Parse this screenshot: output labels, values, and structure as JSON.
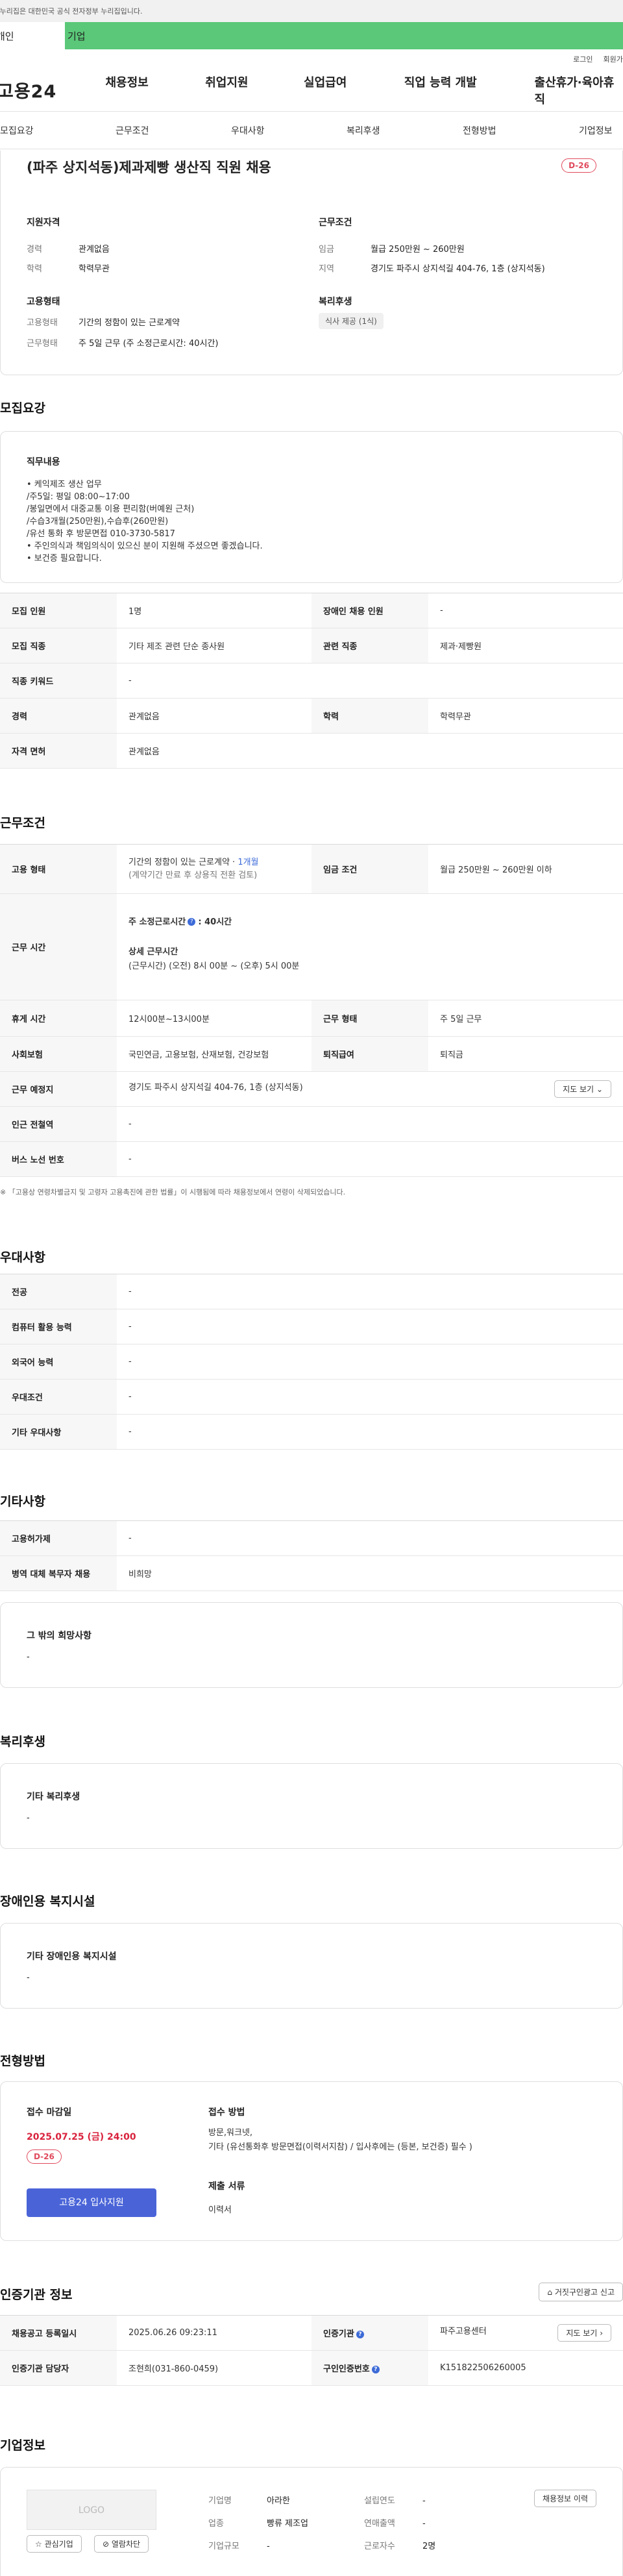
{
  "gov_notice": "이 누리집은 대한민국 공식 전자정부 누리집입니다.",
  "tabs": [
    "개인",
    "기업"
  ],
  "util_links": [
    "로그인",
    "회원가입"
  ],
  "logo": "고용24",
  "gnb": [
    "채용정보",
    "취업지원",
    "실업급여",
    "직업 능력 개발",
    "출산휴가·육아휴직"
  ],
  "snb": [
    "모집요강",
    "근무조건",
    "우대사항",
    "복리후생",
    "전형방법",
    "기업정보"
  ],
  "summary": {
    "title": "(파주 상지석동)제과제빵 생산직 직원 채용",
    "dday": "D-26",
    "qual_title": "지원자격",
    "qual": [
      {
        "k": "경력",
        "v": "관계없음"
      },
      {
        "k": "학력",
        "v": "학력무관"
      }
    ],
    "cond_title": "근무조건",
    "cond": [
      {
        "k": "임금",
        "v": "월급 250만원 ~ 260만원"
      },
      {
        "k": "지역",
        "v": "경기도 파주시 상지석길 404-76, 1층 (상지석동)"
      }
    ],
    "emp_title": "고용형태",
    "emp": [
      {
        "k": "고용형태",
        "v": "기간의 정함이 있는 근로계약"
      },
      {
        "k": "근무형태",
        "v": "주 5일 근무 (주 소정근로시간: 40시간)"
      }
    ],
    "welfare_title": "복리후생",
    "welfare_tag": "식사 제공 (1식)"
  },
  "recruit": {
    "section_title": "모집요강",
    "duty_title": "직무내용",
    "duty_lines": [
      "• 케익제조 생산 업무",
      "/주5일: 평일 08:00~17:00",
      "/봉일면에서 대중교통 이용 편리함(버예원 근처)",
      "/수습3개월(250만원),수습후(260만원)",
      "/유선 통화 후 방문면접 010-3730-5817",
      "• 주인의식과 책임의식이 있으신 분이 지원해 주셨으면 좋겠습니다.",
      "• 보건증 필요합니다."
    ],
    "rows": [
      [
        {
          "k": "모집 인원",
          "v": "1명"
        },
        {
          "k": "장애인 채용 인원",
          "v": "-"
        }
      ],
      [
        {
          "k": "모집 직종",
          "v": "기타 제조 관련 단순 종사원"
        },
        {
          "k": "관련 직종",
          "v": "제과·제빵원"
        }
      ],
      [
        {
          "k": "직종 키워드",
          "v": "-"
        }
      ],
      [
        {
          "k": "경력",
          "v": "관계없음"
        },
        {
          "k": "학력",
          "v": "학력무관"
        }
      ],
      [
        {
          "k": "자격 면허",
          "v": "관계없음"
        }
      ]
    ]
  },
  "work": {
    "section_title": "근무조건",
    "emp_type_k": "고용 형태",
    "emp_type_v1": "기간의 정함이 있는 근로계약 · ",
    "emp_type_highlight": "1개월",
    "emp_type_v2": "(계약기간 만료 후 상용직 전환 검토)",
    "wage_k": "임금 조건",
    "wage_v": "월급 250만원 ~ 260만원 이하",
    "hours_k": "근무 시간",
    "hours_main": "주 소정근로시간",
    "hours_main_v": ": 40시간",
    "hours_detail_title": "상세 근무시간",
    "hours_detail": "(근무시간) (오전) 8시 00분 ~ (오후) 5시 00분",
    "break_k": "휴게 시간",
    "break_v": "12시00분~13시00분",
    "type_k": "근무 형태",
    "type_v": "주 5일 근무",
    "ins_k": "사회보험",
    "ins_v": "국민연금, 고용보험, 산재보험, 건강보험",
    "sev_k": "퇴직급여",
    "sev_v": "퇴직금",
    "place_k": "근무 예정지",
    "place_v": "경기도 파주시 상지석길 404-76, 1층 (상지석동)",
    "map_btn": "지도 보기",
    "station_k": "인근 전철역",
    "station_v": "-",
    "bus_k": "버스 노선 번호",
    "bus_v": "-",
    "note": "※ 「고용상 연령차별금지 및 고령자 고용촉진에 관한 법률」이 시행됨에 따라 채용정보에서 연령이 삭제되었습니다."
  },
  "pref": {
    "section_title": "우대사항",
    "rows": [
      {
        "k": "전공",
        "v": "-"
      },
      {
        "k": "컴퓨터 활용 능력",
        "v": "-"
      },
      {
        "k": "외국어 능력",
        "v": "-"
      },
      {
        "k": "우대조건",
        "v": "-"
      },
      {
        "k": "기타 우대사항",
        "v": "-"
      }
    ]
  },
  "etc": {
    "section_title": "기타사항",
    "rows": [
      {
        "k": "고용허가제",
        "v": "-"
      },
      {
        "k": "병역 대체 복무자 채용",
        "v": "비희망"
      }
    ],
    "wish_title": "그 밖의 희망사항",
    "wish_v": "-"
  },
  "welfare": {
    "section_title": "복리후생",
    "sub_title": "기타 복리후생",
    "v": "-"
  },
  "disabled": {
    "section_title": "장애인용 복지시설",
    "sub_title": "기타 장애인용 복지시설",
    "v": "-"
  },
  "process": {
    "section_title": "전형방법",
    "deadline_title": "접수 마감일",
    "deadline": "2025.07.25 (금) 24:00",
    "dday": "D-26",
    "apply_btn": "고용24 입사지원",
    "method_title": "접수 방법",
    "method_lines": [
      "방문,워크넷,",
      "기타 (유선통화후 방문면접(이력서지참) / 입사후에는 (등본, 보건증) 필수 )"
    ],
    "docs_title": "제출 서류",
    "docs": "이력서"
  },
  "cert": {
    "section_title": "인증기관 정보",
    "report_btn": "거짓구인광고 신고",
    "rows": [
      [
        {
          "k": "채용공고 등록일시",
          "v": "2025.06.26 09:23:11"
        },
        {
          "k": "인증기관",
          "v": "파주고용센터",
          "btn": "지도 보기"
        }
      ],
      [
        {
          "k": "인증기관 담당자",
          "v": "조현희(031-860-0459)"
        },
        {
          "k": "구인인증번호",
          "v": "K151822506260005"
        }
      ]
    ]
  },
  "company": {
    "section_title": "기업정보",
    "logo_text": "LOGO",
    "btn_interest": "관심기업",
    "btn_block": "열람차단",
    "history_btn": "채용정보 이력",
    "fields": [
      {
        "k": "기업명",
        "v": "아라한"
      },
      {
        "k": "업종",
        "v": "빵류 제조업"
      },
      {
        "k": "기업규모",
        "v": "-"
      },
      {
        "k": "설립연도",
        "v": "-"
      },
      {
        "k": "연매출액",
        "v": "-"
      },
      {
        "k": "근로자수",
        "v": "2명"
      }
    ]
  },
  "colors": {
    "accent_green": "#5ac878",
    "dday_red": "#e04a5c",
    "deadline_red": "#d9233d",
    "apply_blue": "#4a64d8",
    "link_blue": "#3d6bd8"
  }
}
